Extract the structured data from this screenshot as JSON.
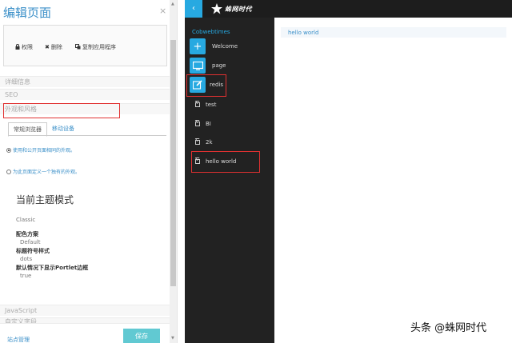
{
  "edit_panel": {
    "title": "编辑页面",
    "close": "×",
    "toolbar": {
      "permissions": "权限",
      "delete": "删除",
      "copy_app": "复制应用程序"
    },
    "sections": {
      "details": "详细信息",
      "seo": "SEO",
      "look_and_feel": "外观和风格",
      "javascript": "JavaScript",
      "custom_meta": "自定义字段"
    },
    "tabs": [
      "常规浏览器",
      "移动设备"
    ],
    "radio_options": [
      {
        "label": "使用和公开页面相同的外观。",
        "checked": true
      },
      {
        "label": "为此页面定义一个独有的外观。",
        "checked": false
      }
    ],
    "theme": {
      "heading": "当前主题模式",
      "name": "Classic",
      "color_scheme_label": "配色方案",
      "color_scheme_value": "Default",
      "bullet_label": "标题符号样式",
      "bullet_value": "dots",
      "portlet_border_label": "默认情况下显示Portlet边框",
      "portlet_border_value": "true"
    },
    "footer": {
      "link": "站点管理",
      "save": "保存"
    }
  },
  "product_menu": {
    "toggle": "‹",
    "logo_text": "蛛网时代",
    "site_name": "Cobwebtimes",
    "items": [
      {
        "label": "Welcome",
        "icon": "plus-icon"
      },
      {
        "label": "page",
        "icon": "monitor-icon"
      },
      {
        "label": "redis",
        "icon": "edit-icon"
      }
    ],
    "pages": [
      "test",
      "BI",
      "2k",
      "hello world"
    ]
  },
  "content": {
    "text": "hello world"
  },
  "watermark": "头条 @蛛网时代",
  "colors": {
    "accent": "#27a9e1",
    "link": "#3a8fc8",
    "highlight": "#e03131",
    "dark_menu": "#222222"
  }
}
